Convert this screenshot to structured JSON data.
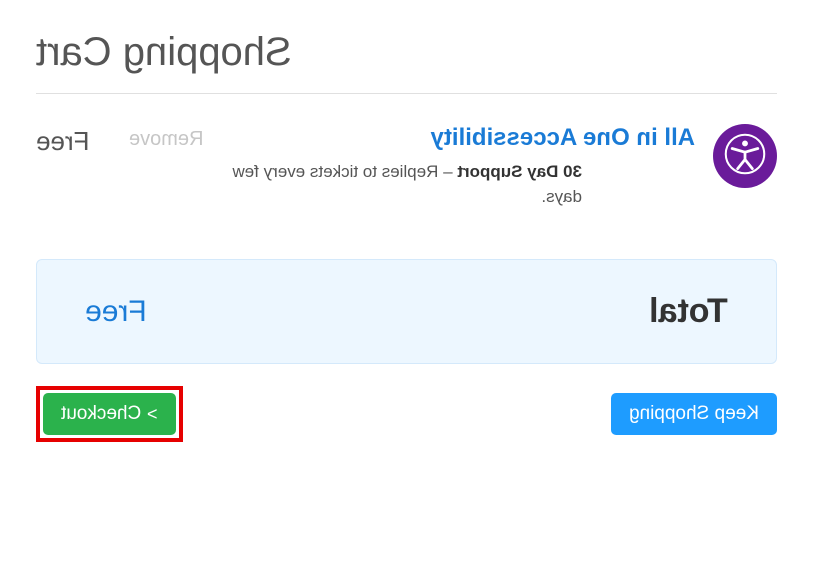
{
  "page": {
    "title": "Shopping Cart"
  },
  "item": {
    "name": "All in One Accessibility",
    "support_label": "30 Day Support",
    "support_desc": " – Replies to tickets every few days.",
    "remove_label": "Remove",
    "price": "Free"
  },
  "totals": {
    "label": "Total",
    "value": "Free"
  },
  "buttons": {
    "keep_shopping": "Keep Shopping",
    "checkout": "Checkout",
    "chevron": ">"
  },
  "colors": {
    "link": "#1a7bd6",
    "accent_blue": "#1e9cff",
    "accent_green": "#2bb24c",
    "highlight_border": "#e60000",
    "avatar_bg": "#6a1b9a"
  }
}
